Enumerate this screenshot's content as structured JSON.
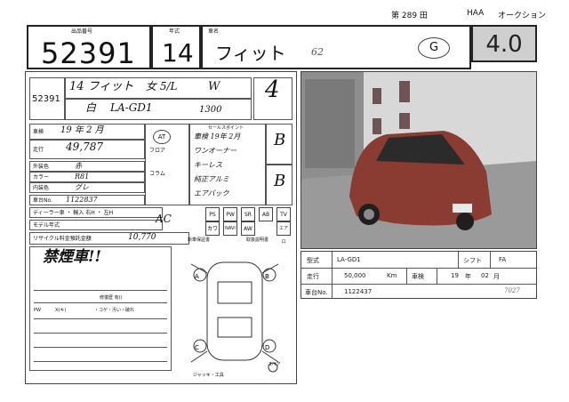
{
  "header": {
    "page_label": "第 289 田",
    "source": "HAA",
    "source_suffix": "オークション"
  },
  "top": {
    "lot_label": "出品番号",
    "lot_number": "52391",
    "year_label": "年式",
    "year": "14",
    "model_label": "車名",
    "model_name": "フィット",
    "note_handwritten": "62",
    "grade_circle": "G",
    "score": "4.0"
  },
  "sheet": {
    "lot_number": "52391",
    "year_model": "14 フィット",
    "type_hand": "女 5/L",
    "grade_hand": "W",
    "color_hand": "白",
    "code_hand": "LA-GD1",
    "cc": "1300",
    "score_hand": "4",
    "reg_label": "車検",
    "reg_value": "19 年 2 月",
    "mileage_label": "走行",
    "mileage_value": "49,787",
    "ext_color_label": "外装色",
    "ext_color_value": "赤",
    "color_code_label": "カラー",
    "color_code_value": "R81",
    "int_color_label": "内装色",
    "int_color_value": "グレ",
    "chassis_label": "車台No.",
    "chassis_value": "1122837",
    "dealer_label": "ディーラー車 ・ 輸入 右H ・ 左H",
    "model_code_label": "モデル年式",
    "recycle_label": "リサイクル料金預託金額",
    "recycle_value": "10,770",
    "ac_hand": "AC",
    "note_big": "禁煙車!!",
    "inspection_note": "修復歴 有()",
    "bottom_note": "・コゲ・汚い・破れ",
    "pw_label": "PW",
    "xkey_label": "X(キ)",
    "sales_points_label": "セールスポイント",
    "sales_points": [
      "車検 19年 2月",
      "ワンオーナー",
      "キーレス",
      "純正アルミ",
      "エアバック"
    ],
    "at_label": "AT",
    "floor_label": "フロア",
    "column_label": "コラム",
    "grade_int": "B",
    "grade_ext": "B",
    "equipment": [
      "PS",
      "PW",
      "SR",
      "AB",
      "TV",
      "エアロ"
    ],
    "equipment_row2": [
      "カワ",
      "NAVI",
      "AW"
    ],
    "new_car_label": "新車保証書",
    "manual_label": "取扱説明書",
    "jack_label": "ジャッキ・工具",
    "spare_label": "スペア",
    "diagram_letters": [
      "A",
      "B",
      "C",
      "D"
    ]
  },
  "info": {
    "model_type_label": "型式",
    "model_type_value": "LA-GD1",
    "shift_label": "シフト",
    "shift_value": "FA",
    "mileage_label": "走行",
    "mileage_value": "50,000",
    "mileage_unit": "Km",
    "inspection_label": "車検",
    "inspection_year": "19",
    "inspection_year_unit": "年",
    "inspection_month": "02",
    "inspection_month_unit": "月",
    "chassis_label": "車台No.",
    "chassis_value": "1122437",
    "hand_note": "7027"
  },
  "colors": {
    "car_body": "#8a3b32",
    "photo_bg": "#b9b9b9",
    "score_bg": "#cfcfcf"
  }
}
